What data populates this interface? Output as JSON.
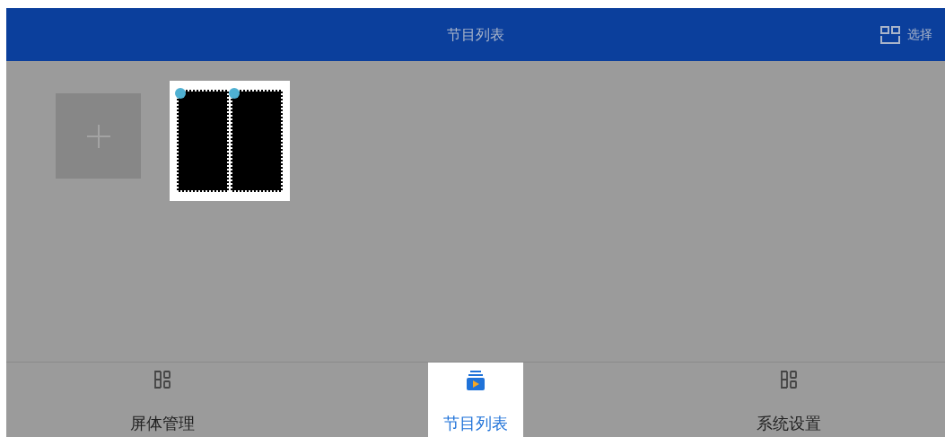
{
  "header": {
    "title": "节目列表",
    "action": "选择"
  },
  "programs": [
    {
      "kind": "add"
    },
    {
      "kind": "program",
      "selected": false
    }
  ],
  "tabs": [
    {
      "label": "屏体管理",
      "selected": false
    },
    {
      "label": "节目列表",
      "selected": true
    },
    {
      "label": "系统设置",
      "selected": false
    }
  ]
}
